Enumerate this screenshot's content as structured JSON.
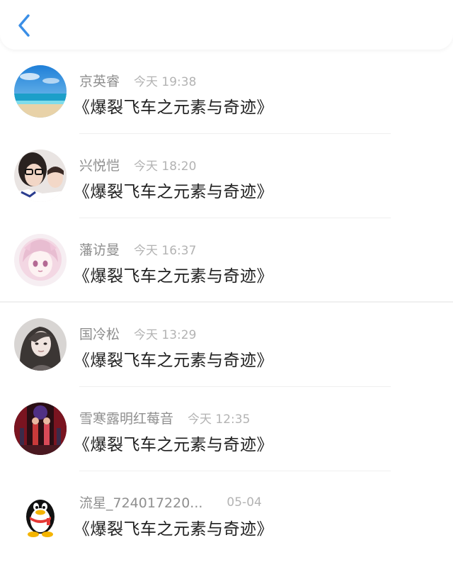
{
  "header": {
    "back_icon": "chevron-left-icon",
    "accent_color": "#3a8ee6"
  },
  "messages": [
    {
      "name": "京英睿",
      "time": "今天 19:38",
      "text": "《爆裂飞车之元素与奇迹》",
      "avatar": "beach-photo"
    },
    {
      "name": "兴悦恺",
      "time": "今天 18:20",
      "text": "《爆裂飞车之元素与奇迹》",
      "avatar": "selfie-photo"
    },
    {
      "name": "藩访曼",
      "time": "今天 16:37",
      "text": "《爆裂飞车之元素与奇迹》",
      "avatar": "anime-girl-illustration"
    },
    {
      "name": "国冷松",
      "time": "今天 13:29",
      "text": "《爆裂飞车之元素与奇迹》",
      "avatar": "portrait-photo"
    },
    {
      "name": "雪寒露明红莓音",
      "time": "今天 12:35",
      "text": "《爆裂飞车之元素与奇迹》",
      "avatar": "stage-photo"
    },
    {
      "name": "流星_724017220...",
      "time": "05-04",
      "text": "《爆裂飞车之元素与奇迹》",
      "avatar": "qq-penguin"
    }
  ]
}
